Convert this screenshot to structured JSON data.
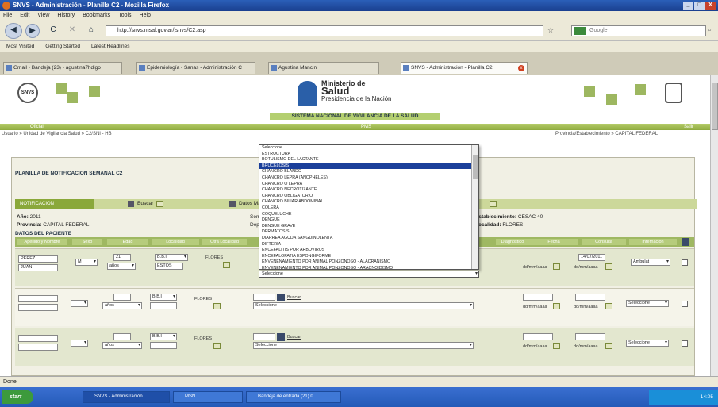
{
  "window": {
    "title": "SNVS - Administración - Planilla C2 - Mozilla Firefox",
    "min": "_",
    "max": "□",
    "close": "X"
  },
  "menu": [
    "File",
    "Edit",
    "View",
    "History",
    "Bookmarks",
    "Tools",
    "Help"
  ],
  "nav": {
    "back": "◀",
    "forward": "▶",
    "reload": "C",
    "stop": "✕",
    "home": "⌂",
    "url": "http://snvs.msal.gov.ar/jsnvs/C2.asp",
    "search_placeholder": "Google"
  },
  "bookmarks": [
    "Most Visited",
    "Getting Started",
    "Latest Headlines"
  ],
  "tabs": [
    {
      "label": "Gmail - Bandeja (23) - agustina7hdigo",
      "active": false
    },
    {
      "label": "Epidemiología - Sanas - Administración C",
      "active": false
    },
    {
      "label": "Agustina Mancini",
      "active": false
    },
    {
      "label": "SNVS - Administración - Planilla C2",
      "active": true
    }
  ],
  "banner": {
    "ministry_line1": "Ministerio de",
    "ministry_line2": "Salud",
    "ministry_line3": "Presidencia de la Nación",
    "system_name": "SISTEMA NACIONAL DE VIGILANCIA DE LA SALUD",
    "bar_left": "Oficial",
    "bar_center": "PMS",
    "bar_right": "Salir",
    "user_left": "Usuario » Unidad de Vigilancia Salud » C2/SNI - HB",
    "user_right": "Provincia/Establecimiento » CAPITAL FEDERAL"
  },
  "form": {
    "title": "PLANILLA DE NOTIFICACION SEMANAL C2",
    "section_tab": "NOTIFICACION",
    "tab_items": [
      "Buscar",
      "Datos Ma..."
    ],
    "info_left": [
      {
        "label": "Año:",
        "value": "2011"
      },
      {
        "label": "Provincia:",
        "value": "CAPITAL FEDERAL"
      }
    ],
    "info_mid": [
      "Sem",
      "Depl"
    ],
    "info_right": [
      {
        "label": "Establecimiento:",
        "value": "CESAC 40"
      },
      {
        "label": "Localidad:",
        "value": "FLORES"
      }
    ],
    "patients_header": "DATOS DEL PACIENTE",
    "columns": [
      "Apellido y Nombre",
      "Sexo",
      "Edad",
      "Localidad",
      "Otra Localidad",
      "Diagnóstico",
      "Fecha",
      "Consulta",
      "Internación",
      "Borrar"
    ]
  },
  "rows": [
    {
      "surname": "PEREZ",
      "name": "JUAN",
      "sex": "M",
      "age": "21",
      "age_unit": "años",
      "loc_code": "B.B.I",
      "loc_name": "FLORES",
      "other_loc": "ESTOS",
      "diagnosis": "Seleccionar",
      "date1": "14/07/2011",
      "date1_lbl": "dd/mm/aaaa",
      "date2_lbl": "dd/mm/aaaa",
      "outcome": "Ambulat"
    },
    {
      "surname": "",
      "name": "",
      "sex": "",
      "age": "",
      "age_unit": "años",
      "loc_code": "B.B.I",
      "loc_name": "FLORES",
      "other_loc": "",
      "diagnosis": "Seleccione",
      "search": "Buscar",
      "date1": "",
      "date1_lbl": "dd/mm/aaaa",
      "date2_lbl": "dd/mm/aaaa",
      "outcome": "Seleccione"
    },
    {
      "surname": "",
      "name": "",
      "sex": "",
      "age": "",
      "age_unit": "años",
      "loc_code": "B.B.I",
      "loc_name": "FLORES",
      "other_loc": "",
      "diagnosis": "Seleccione",
      "search": "Buscar",
      "date1": "",
      "date1_lbl": "dd/mm/aaaa",
      "date2_lbl": "dd/mm/aaaa",
      "outcome": "Seleccione"
    }
  ],
  "dropdown": {
    "items": [
      "Seleccione",
      "ESTRUCTURA",
      "BOTULISMO DEL LACTANTE",
      "BRUCELOSIS",
      "CHANCRO BLANDO",
      "CHANCRO LEPRA (ANOPHELES)",
      "CHANCRO O LEPRA",
      "CHANCRO NECROTIZANTE",
      "CHANCRO OBLIGATORIO",
      "CHANCRO BILIAR ABDOMINAL",
      "COLERA",
      "COQUELUCHE",
      "DENGUE",
      "DENGUE GRAVE",
      "DERMATOSIS",
      "DIARREA AGUDA SANGUINOLENTA",
      "DIFTERIA",
      "ENCEFALITIS POR ARBOVIRUS",
      "ENCEFALOPATIA ESPONGIFORME",
      "ENVENENAMIENTO POR ANIMAL PONZOÑOSO - ALACRANISMO",
      "ENVENENAMIENTO POR ANIMAL PONZOÑOSO - ARACNOIDISMO"
    ],
    "selected_index": 3,
    "footer": "Seleccione"
  },
  "status": "Done",
  "taskbar": {
    "start": "start",
    "tasks": [
      "SNVS - Administración...",
      "MSN",
      "Bandeja de entrada (21) 0..."
    ],
    "time": "14:05"
  }
}
